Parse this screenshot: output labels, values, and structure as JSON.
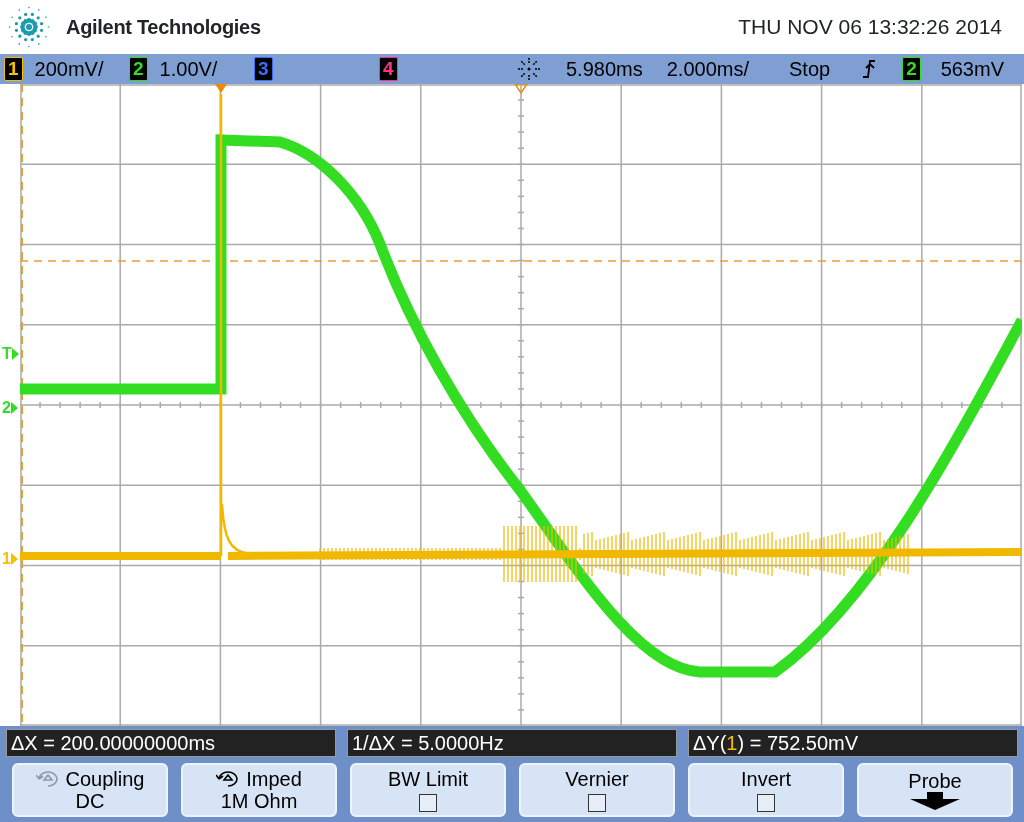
{
  "header": {
    "brand": "Agilent Technologies",
    "datetime": "THU NOV 06 13:32:26 2014"
  },
  "status_bar": {
    "channels": [
      {
        "label": "1",
        "scale": "200mV/",
        "color": "#f5c000"
      },
      {
        "label": "2",
        "scale": "1.00V/",
        "color": "#33dd22"
      },
      {
        "label": "3",
        "color": "#3a6cff"
      },
      {
        "label": "4",
        "color": "#ff3388"
      }
    ],
    "delay": "5.980ms",
    "timebase": "2.000ms/",
    "run_state": "Stop",
    "trigger_source": {
      "label": "2",
      "color": "#33dd22"
    },
    "trigger_level": "563mV"
  },
  "display": {
    "markers": [
      {
        "label": "T",
        "color": "#33dd22"
      },
      {
        "label": "2",
        "color": "#33dd22"
      },
      {
        "label": "1",
        "color": "#f5c000"
      }
    ]
  },
  "measurements": [
    {
      "text": "ΔX = 200.00000000ms"
    },
    {
      "text": "1/ΔX = 5.0000Hz"
    },
    {
      "text": "ΔY(",
      "channel": "1",
      "color": "#f5c000",
      "text_after": ") = 752.50mV"
    }
  ],
  "softkeys": [
    {
      "kind": "value",
      "label": "Coupling",
      "value": "DC",
      "cycle_active": false
    },
    {
      "kind": "value",
      "label": "Imped",
      "value": "1M Ohm",
      "cycle_active": true
    },
    {
      "kind": "checkbox",
      "label": "BW Limit",
      "checked": false
    },
    {
      "kind": "checkbox",
      "label": "Vernier",
      "checked": false
    },
    {
      "kind": "checkbox",
      "label": "Invert",
      "checked": false
    },
    {
      "kind": "submenu",
      "label": "Probe"
    }
  ]
}
